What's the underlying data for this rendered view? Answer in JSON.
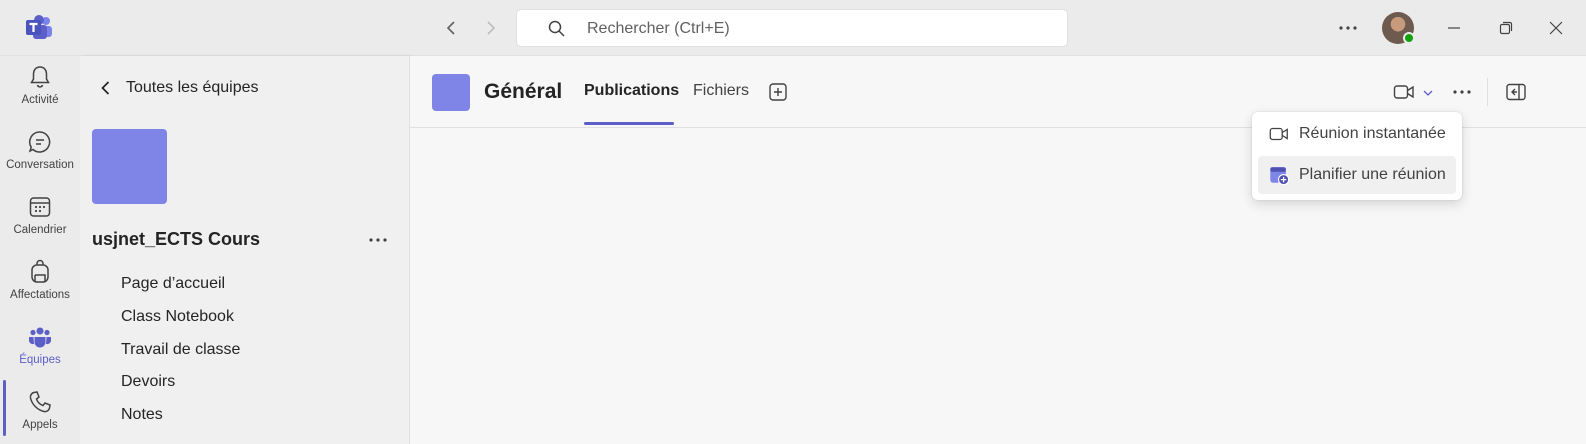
{
  "titlebar": {
    "search_placeholder": "Rechercher (Ctrl+E)"
  },
  "rail": {
    "items": [
      {
        "label": "Activité",
        "icon": "bell-icon"
      },
      {
        "label": "Conversation",
        "icon": "chat-icon"
      },
      {
        "label": "Calendrier",
        "icon": "calendar-icon"
      },
      {
        "label": "Affectations",
        "icon": "backpack-icon"
      },
      {
        "label": "Équipes",
        "icon": "teams-icon"
      },
      {
        "label": "Appels",
        "icon": "phone-icon"
      }
    ],
    "active_index": 4
  },
  "pane": {
    "back_label": "Toutes les équipes",
    "team_name": "usjnet_ECTS Cours",
    "channels": [
      "Page d’accueil",
      "Class Notebook",
      "Travail de classe",
      "Devoirs",
      "Notes"
    ]
  },
  "main": {
    "channel_title": "Général",
    "tabs": [
      {
        "label": "Publications",
        "active": true
      },
      {
        "label": "Fichiers",
        "active": false
      }
    ]
  },
  "meet_menu": {
    "items": [
      {
        "label": "Réunion instantanée",
        "icon": "video-camera-icon"
      },
      {
        "label": "Planifier une réunion",
        "icon": "calendar-add-icon"
      }
    ]
  },
  "colors": {
    "accent": "#5b5fc7",
    "team_tile": "#7f85e6",
    "presence": "#13a10e"
  }
}
